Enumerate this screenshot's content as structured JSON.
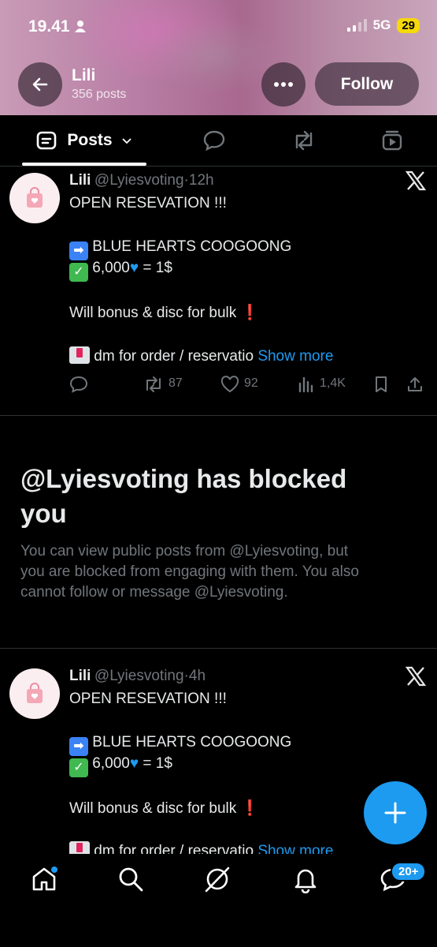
{
  "status_bar": {
    "time": "19.41",
    "network": "5G",
    "battery": "29"
  },
  "header": {
    "name": "Lili",
    "posts_count": "356 posts",
    "follow_label": "Follow"
  },
  "tabs": [
    {
      "label": "Posts"
    }
  ],
  "posts": [
    {
      "name": "Lili",
      "handle": "@Lyiesvoting",
      "time": "·12h",
      "lines": [
        "OPEN RESEVATION !!!",
        "BLUE HEARTS COOGOONG",
        "6,000",
        "= 1$",
        "Will bonus & disc for bulk",
        "dm for order / reservatio"
      ],
      "show_more": "Show more",
      "retweets": "87",
      "likes": "92",
      "views": "1,4K"
    },
    {
      "name": "Lili",
      "handle": "@Lyiesvoting",
      "time": "·4h",
      "lines": [
        "OPEN RESEVATION !!!",
        "BLUE HEARTS COOGOONG",
        "6,000",
        "= 1$",
        "Will bonus & disc for bulk",
        "dm for order / reservatio"
      ],
      "show_more": "Show more"
    }
  ],
  "blocked": {
    "title_line1": "@Lyiesvoting has blocked",
    "title_line2": "you",
    "line1": "You can view public posts from @Lyiesvoting, but",
    "line2": "you are blocked from engaging with them. You also",
    "line3": "cannot follow or message @Lyiesvoting."
  },
  "bottom_nav": {
    "notifications_badge": "20+"
  },
  "colors": {
    "accent": "#1d9bf0",
    "background": "#000000",
    "muted": "#71767b"
  }
}
